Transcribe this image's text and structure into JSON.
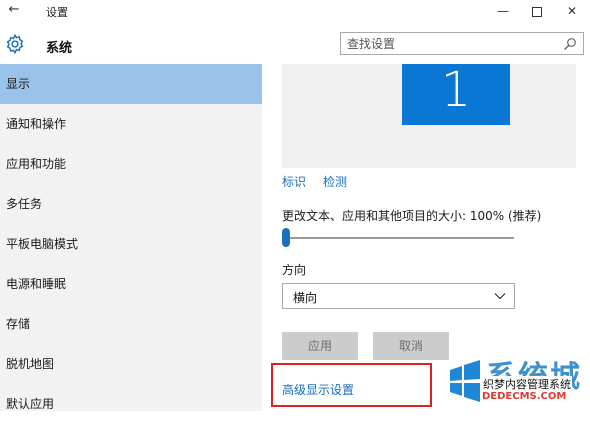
{
  "window": {
    "title": "设置",
    "back_glyph": "←",
    "minimize_glyph": "—",
    "close_glyph": "✕"
  },
  "header": {
    "icon": "gear-icon",
    "title": "系统",
    "search_placeholder": "查找设置"
  },
  "sidebar": {
    "items": [
      {
        "label": "显示",
        "selected": true
      },
      {
        "label": "通知和操作",
        "selected": false
      },
      {
        "label": "应用和功能",
        "selected": false
      },
      {
        "label": "多任务",
        "selected": false
      },
      {
        "label": "平板电脑模式",
        "selected": false
      },
      {
        "label": "电源和睡眠",
        "selected": false
      },
      {
        "label": "存储",
        "selected": false
      },
      {
        "label": "脱机地图",
        "selected": false
      },
      {
        "label": "默认应用",
        "selected": false
      }
    ]
  },
  "display": {
    "monitor_number": "1",
    "identify_link": "标识",
    "detect_link": "检测",
    "scale_label": "更改文本、应用和其他项目的大小: 100% (推荐)",
    "scale_slider_level": 0,
    "orientation_label": "方向",
    "orientation_value": "横向",
    "apply_button": "应用",
    "cancel_button": "取消",
    "advanced_link": "高级显示设置"
  },
  "watermark": {
    "big_text": "系统城",
    "line1": "织梦内容管理系统",
    "line2": "DEDECMS.COM"
  },
  "colors": {
    "accent": "#0a77d5",
    "selected_nav": "#99c3e8",
    "link": "#1a6fbf",
    "highlight_box": "#e02020"
  }
}
